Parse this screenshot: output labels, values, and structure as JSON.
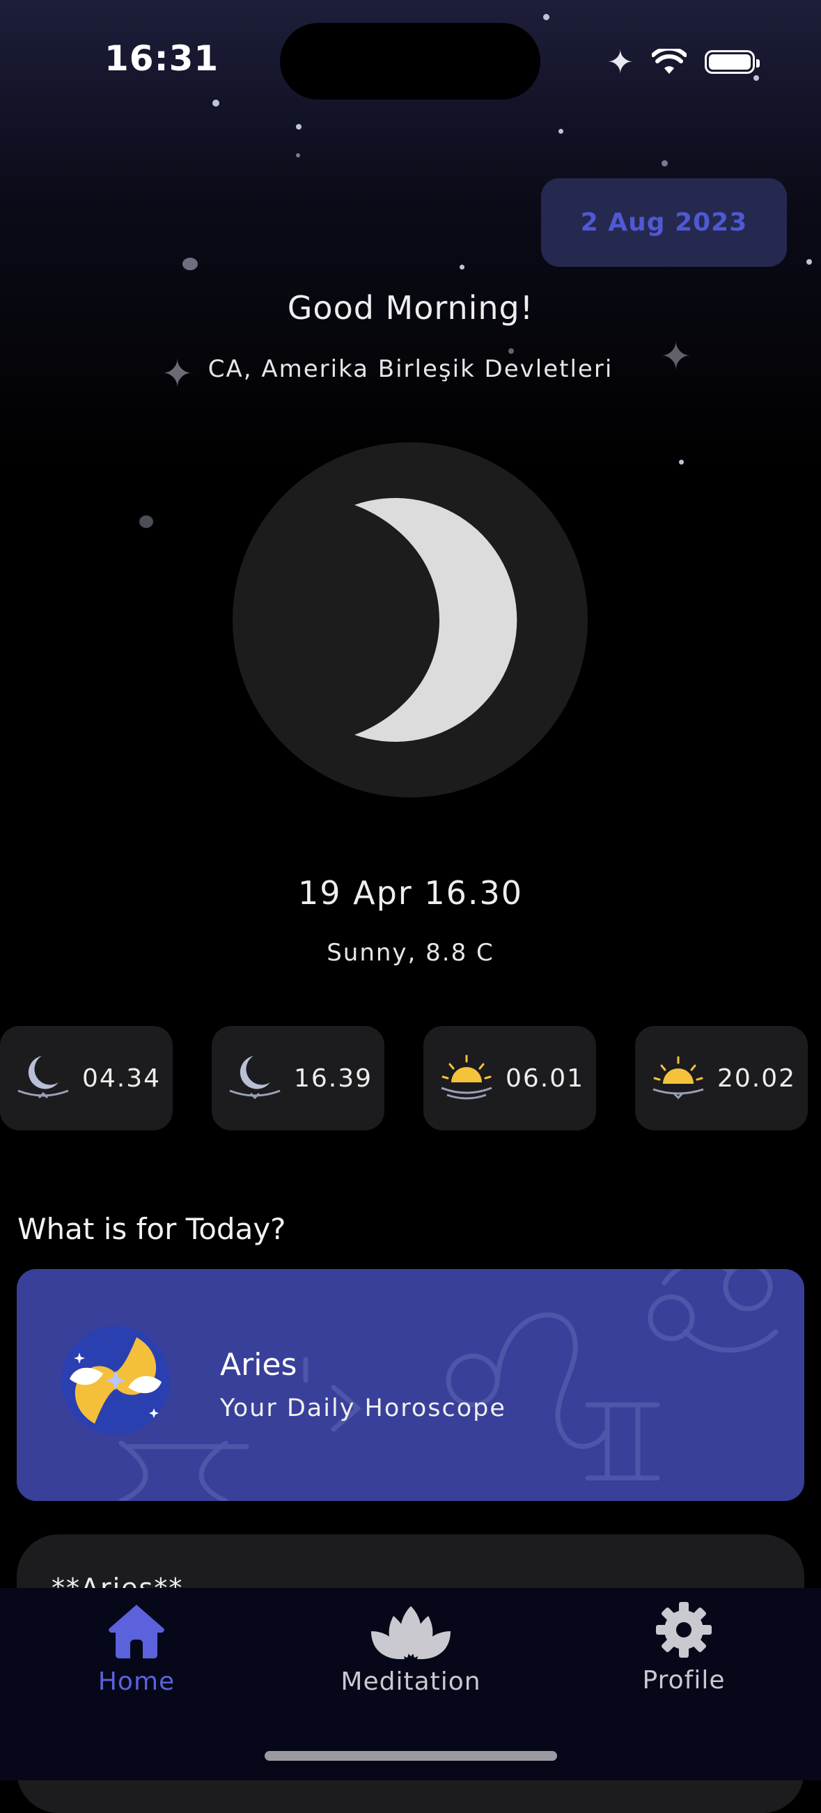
{
  "status_bar": {
    "time": "16:31"
  },
  "header": {
    "date_chip": "2 Aug 2023",
    "greeting": "Good Morning!",
    "location": "CA, Amerika Birleşik Devletleri"
  },
  "moon": {
    "datetime": "19 Apr 16.30",
    "weather": "Sunny, 8.8 C"
  },
  "times": [
    {
      "icon": "moonrise-icon",
      "value": "04.34"
    },
    {
      "icon": "moonset-icon",
      "value": "16.39"
    },
    {
      "icon": "sunrise-icon",
      "value": "06.01"
    },
    {
      "icon": "sunset-icon",
      "value": "20.02"
    }
  ],
  "today": {
    "title": "What is for Today?",
    "sign_name": "Aries",
    "subtitle": "Your Daily Horoscope"
  },
  "horoscope_text": {
    "preview": "**Aries**"
  },
  "tabs": [
    {
      "label": "Home",
      "icon": "home-icon",
      "active": true
    },
    {
      "label": "Meditation",
      "icon": "lotus-icon",
      "active": false
    },
    {
      "label": "Profile",
      "icon": "gear-icon",
      "active": false
    }
  ],
  "colors": {
    "accent": "#5b62dc",
    "card": "#39409a",
    "date_chip_bg": "#26294f"
  }
}
